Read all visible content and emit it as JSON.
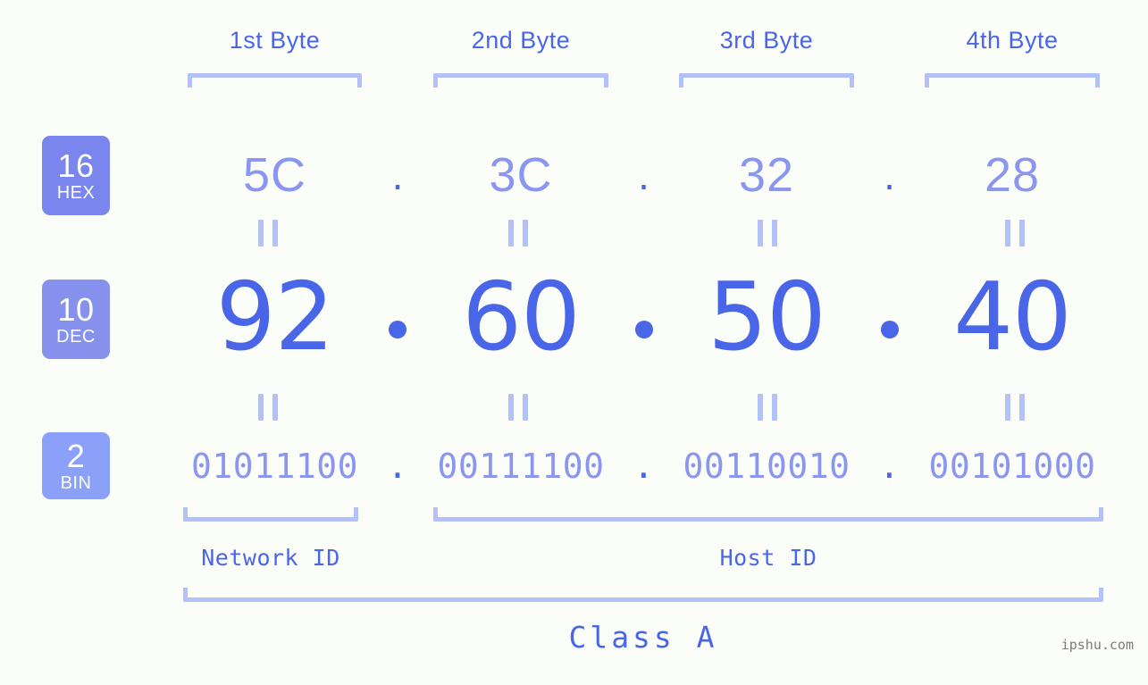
{
  "background_color": "#fbfdf8",
  "accent_colors": {
    "strong_blue": "#4a66e8",
    "mid_blue": "#8a96f0",
    "light_lavender": "#b4c0f8",
    "badge_hex": "#7a86ee",
    "badge_dec": "#8691ee",
    "badge_bin": "#8ba0f8",
    "watermark_gray": "#7b7b7b"
  },
  "byte_headers": [
    {
      "label": "1st Byte"
    },
    {
      "label": "2nd Byte"
    },
    {
      "label": "3rd Byte"
    },
    {
      "label": "4th Byte"
    }
  ],
  "bases": [
    {
      "number": "16",
      "name": "HEX"
    },
    {
      "number": "10",
      "name": "DEC"
    },
    {
      "number": "2",
      "name": "BIN"
    }
  ],
  "rows": {
    "hex": {
      "base_number": "16",
      "base_name": "HEX",
      "values": [
        "5C",
        "3C",
        "32",
        "28"
      ],
      "separator": "."
    },
    "dec": {
      "base_number": "10",
      "base_name": "DEC",
      "values": [
        "92",
        "60",
        "50",
        "40"
      ],
      "separator": "."
    },
    "bin": {
      "base_number": "2",
      "base_name": "BIN",
      "values": [
        "01011100",
        "00111100",
        "00110010",
        "00101000"
      ],
      "separator": "."
    }
  },
  "id_sections": [
    {
      "label": "Network ID"
    },
    {
      "label": "Host ID"
    }
  ],
  "class_label": "Class A",
  "watermark": "ipshu.com",
  "equality_marks": {
    "glyph": "="
  }
}
